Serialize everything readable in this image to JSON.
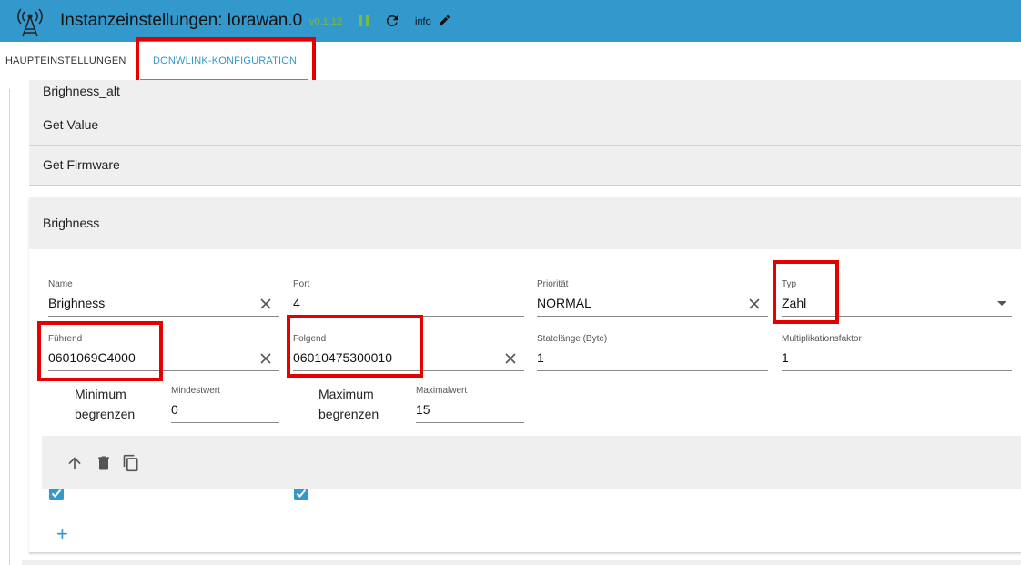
{
  "header": {
    "title": "Instanzeinstellungen: lorawan.0",
    "version": "v0.1.12",
    "info_label": "info",
    "bg_color": "#3399cc"
  },
  "tabs": [
    {
      "label": "HAUPTEINSTELLUNGEN",
      "active": false
    },
    {
      "label": "DONWLINK-KONFIGURATION",
      "active": true
    }
  ],
  "collapsed_items": [
    {
      "label": "Brighness_alt"
    },
    {
      "label": "Get Value"
    },
    {
      "label": "Get Firmware"
    }
  ],
  "panel": {
    "title": "Brighness",
    "fields": {
      "name": {
        "label": "Name",
        "value": "Brighness"
      },
      "port": {
        "label": "Port",
        "value": "4"
      },
      "priority": {
        "label": "Priorität",
        "value": "NORMAL"
      },
      "type": {
        "label": "Typ",
        "value": "Zahl"
      },
      "leading": {
        "label": "Führend",
        "value": "0601069C4000"
      },
      "following": {
        "label": "Folgend",
        "value": "06010475300010"
      },
      "state_length": {
        "label": "Statelänge (Byte)",
        "value": "1"
      },
      "multiplier": {
        "label": "Multiplikationsfaktor",
        "value": "1"
      },
      "min_value": {
        "label": "Mindestwert",
        "value": "0"
      },
      "max_value": {
        "label": "Maximalwert",
        "value": "15"
      }
    },
    "limit_min": {
      "label": "Minimum begrenzen",
      "checked": true
    },
    "limit_max": {
      "label": "Maximum begrenzen",
      "checked": true
    },
    "toolbar_icons": [
      "arrow-up-icon",
      "trash-icon",
      "copy-icon"
    ]
  },
  "add_button_label": "+",
  "colors": {
    "accent": "#3399cc",
    "highlight": "#e40000",
    "panel_bg": "#efefef"
  }
}
